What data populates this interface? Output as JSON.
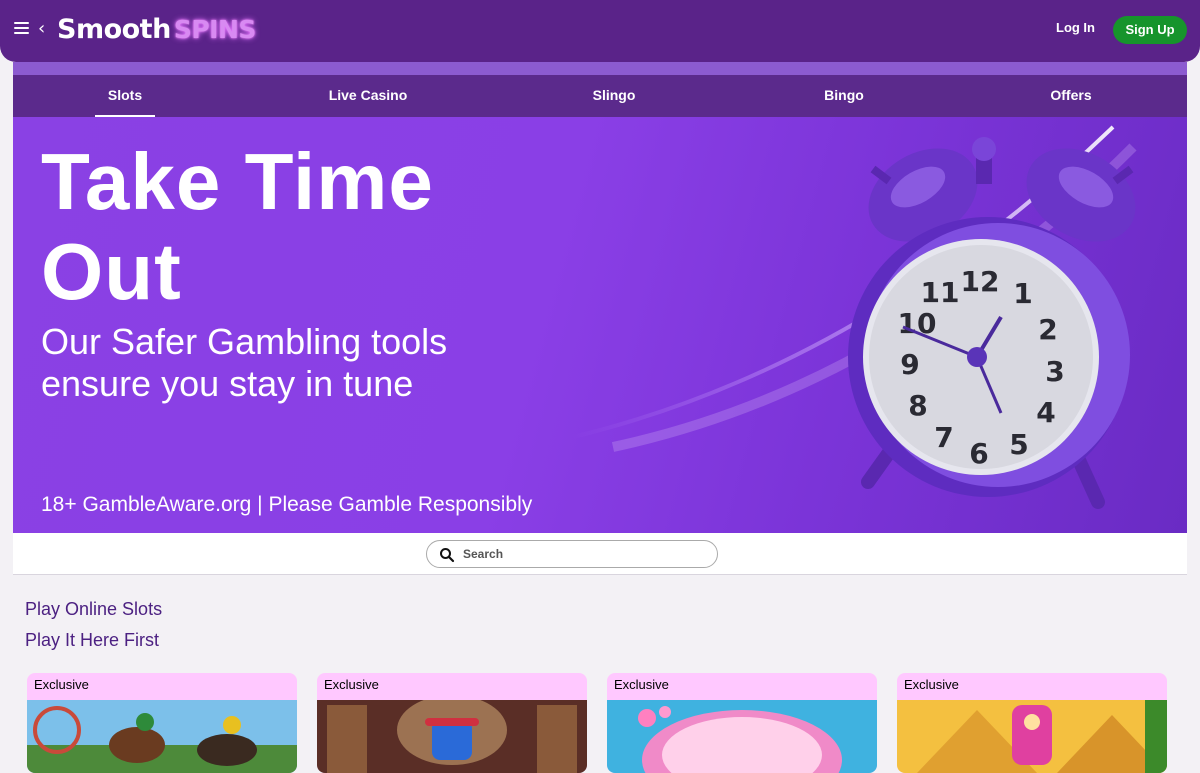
{
  "header": {
    "logo_primary": "Smooth",
    "logo_secondary": "SPINS",
    "login_label": "Log In",
    "signup_label": "Sign Up"
  },
  "nav": {
    "tabs": [
      {
        "label": "Slots",
        "active": true
      },
      {
        "label": "Live Casino",
        "active": false
      },
      {
        "label": "Slingo",
        "active": false
      },
      {
        "label": "Bingo",
        "active": false
      },
      {
        "label": "Offers",
        "active": false
      }
    ]
  },
  "banner": {
    "title_line1": "Take Time",
    "title_line2": "Out",
    "subtitle_line1": "Our Safer Gambling tools",
    "subtitle_line2": "ensure you stay in tune",
    "footer": "18+ GambleAware.org | Please Gamble Responsibly",
    "clock_numbers": [
      "12",
      "1",
      "2",
      "3",
      "4",
      "5",
      "6",
      "7",
      "8",
      "9",
      "10",
      "11"
    ]
  },
  "search": {
    "placeholder": "Search"
  },
  "section": {
    "heading1": "Play Online Slots",
    "heading2": "Play It Here First"
  },
  "games": [
    {
      "badge": "Exclusive"
    },
    {
      "badge": "Exclusive"
    },
    {
      "badge": "Exclusive"
    },
    {
      "badge": "Exclusive"
    }
  ],
  "colors": {
    "header_bg": "#5a2389",
    "nav_bg": "#5b2a8c",
    "banner_bg": "#8a41e4",
    "signup_bg": "#16942c",
    "badge_bg": "#ffc8ff",
    "heading_text": "#4c2182"
  },
  "icons": {
    "menu": "hamburger-icon",
    "back": "chevron-left-icon",
    "search": "search-icon"
  }
}
